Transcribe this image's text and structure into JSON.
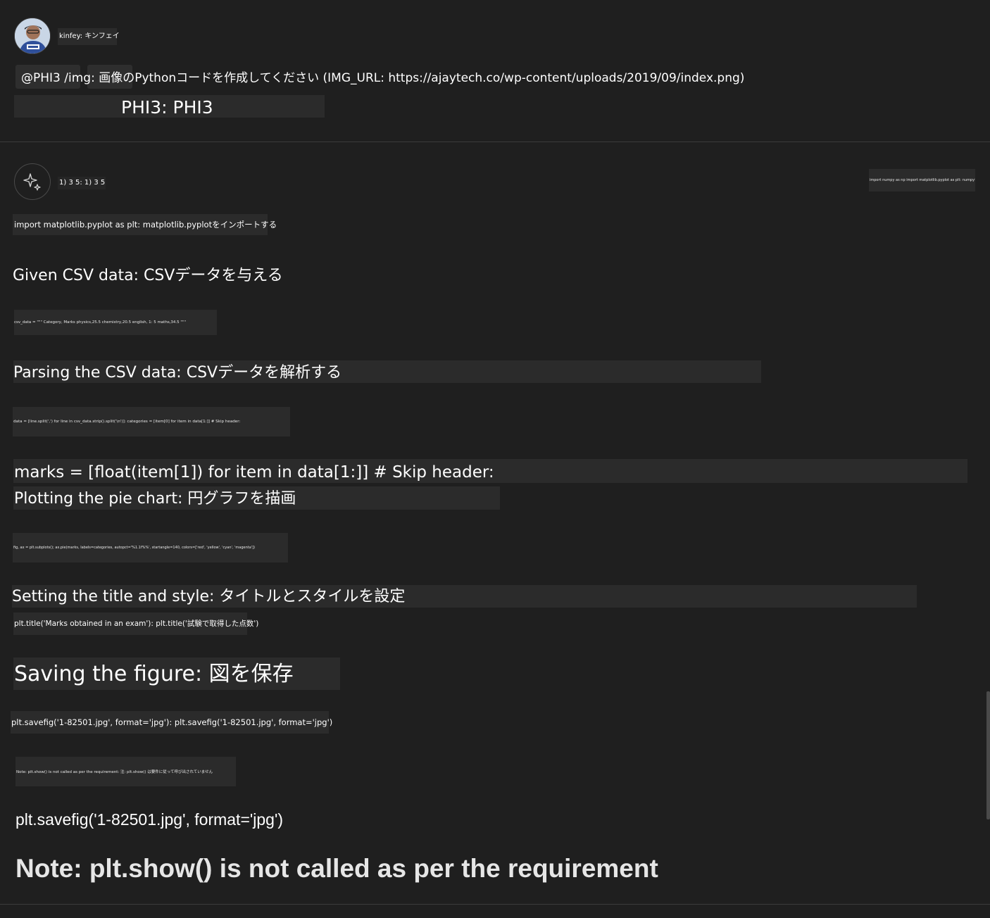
{
  "user": {
    "avatar_icon": "user-photo-avatar",
    "name": "kinfey: キンフェイ"
  },
  "prompt": {
    "text": "@PHI3 /img: 画像のPythonコードを作成してください (IMG_URL: https://ajaytech.co/wp-content/uploads/2019/09/index.png)",
    "agent_label": "PHI3: PHI3"
  },
  "response": {
    "bot_icon": "sparkle-icon",
    "header": "1) 3 5: 1) 3 5",
    "top_right_snippet": "import numpy as np import matplotlib.pyplot as plt: numpyをインポートする ...",
    "lines": {
      "import_line": "import matplotlib.pyplot as plt: matplotlib.pyplotをインポートする",
      "given_csv_heading": "Given CSV data: CSVデータを与える",
      "csv_data_code": "csv_data = \"\"\" Category, Marks physics,25.5 chemistry,20.5 english, 1: 5 maths,34.5 \"\"\"",
      "parsing_heading": "Parsing the CSV data: CSVデータを解析する",
      "parse_code": "data = [line.split(',') for line in csv_data.strip().split('\\n')]: categories = [item[0] for item in data[1:]] # Skip header:",
      "marks_line": "marks = [float(item[1]) for item in data[1:]] # Skip header:",
      "plotting_heading": "Plotting the pie chart: 円グラフを描画",
      "plot_code": "fig, ax = plt.subplots(); ax.pie(marks, labels=categories, autopct='%1.1f%%', startangle=140, colors=['red', 'yellow', 'cyan', 'magenta'])",
      "title_heading": "Setting the title and style: タイトルとスタイルを設定",
      "title_code": "plt.title('Marks obtained in an exam'): plt.title('試験で取得した点数')",
      "saving_heading": "Saving the figure: 図を保存",
      "savefig_code": "plt.savefig('1-82501.jpg', format='jpg'): plt.savefig('1-82501.jpg', format='jpg')",
      "note_small": "Note: plt.show() is not called as per the requirement: 注: plt.show() は要件に従って呼び出されていません",
      "savefig_plain": "plt.savefig('1-82501.jpg', format='jpg')",
      "note_large": "Note: plt.show() is not called as per the requirement"
    }
  },
  "colors": {
    "background": "#1f1f1f",
    "highlight": "#2b2b2b",
    "text": "#ffffff",
    "divider": "#3c3c3c"
  }
}
